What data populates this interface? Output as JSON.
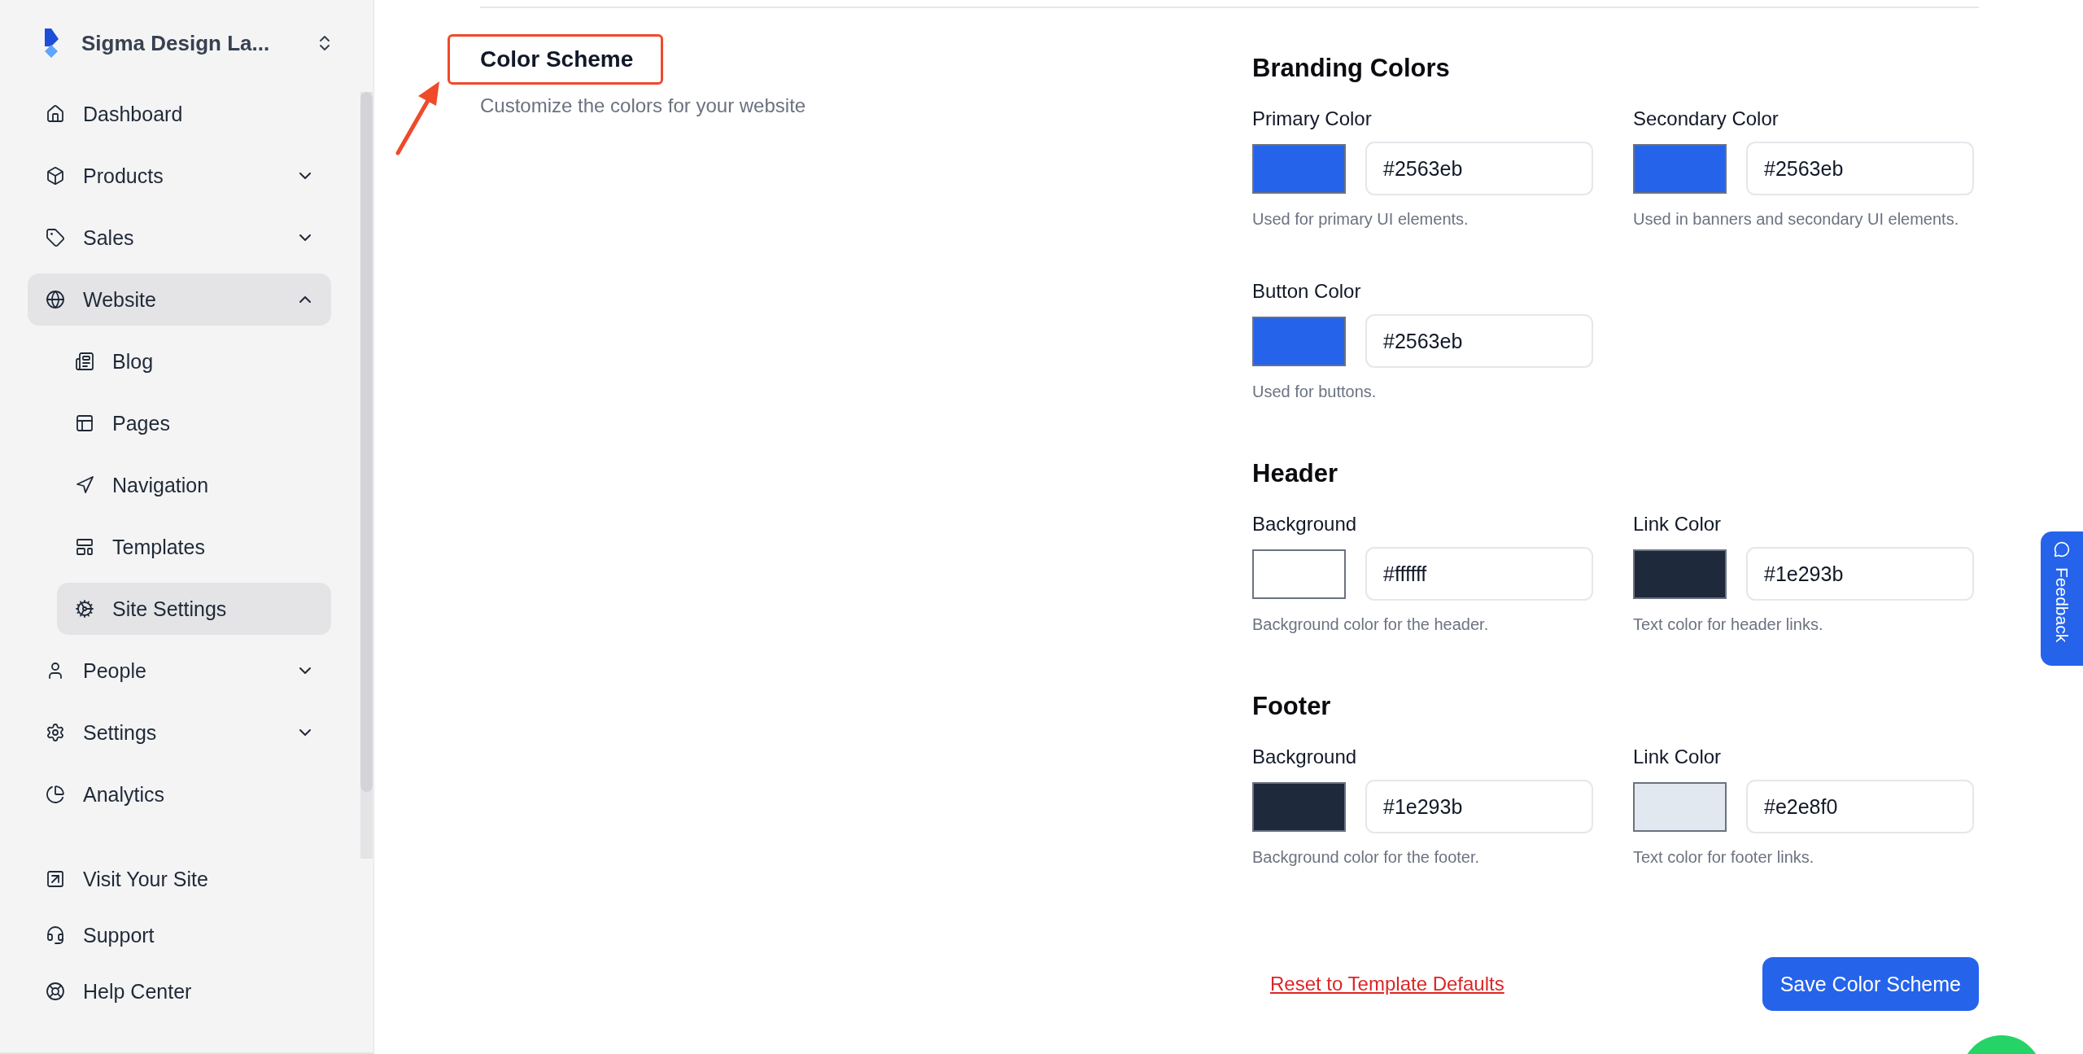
{
  "sidebar": {
    "workspace": "Sigma Design La...",
    "items": [
      {
        "label": "Dashboard",
        "selected": false
      },
      {
        "label": "Products",
        "selected": false,
        "expanded": false
      },
      {
        "label": "Sales",
        "selected": false,
        "expanded": false
      },
      {
        "label": "Website",
        "selected": true,
        "expanded": true,
        "children": [
          {
            "label": "Blog",
            "selected": false
          },
          {
            "label": "Pages",
            "selected": false
          },
          {
            "label": "Navigation",
            "selected": false
          },
          {
            "label": "Templates",
            "selected": false
          },
          {
            "label": "Site Settings",
            "selected": true
          }
        ]
      },
      {
        "label": "People",
        "selected": false,
        "expanded": false
      },
      {
        "label": "Settings",
        "selected": false,
        "expanded": false
      },
      {
        "label": "Analytics",
        "selected": false
      }
    ],
    "footer_links": [
      "Visit Your Site",
      "Support",
      "Help Center"
    ]
  },
  "page": {
    "title": "Color Scheme",
    "description": "Customize the colors for your website"
  },
  "sections": [
    {
      "title": "Branding Colors",
      "fields": [
        {
          "label": "Primary Color",
          "color": "#2563eb",
          "value": "#2563eb",
          "hint": "Used for primary UI elements."
        },
        {
          "label": "Secondary Color",
          "color": "#2563eb",
          "value": "#2563eb",
          "hint": "Used in banners and secondary UI elements."
        },
        {
          "label": "Button Color",
          "color": "#2563eb",
          "value": "#2563eb",
          "hint": "Used for buttons."
        }
      ]
    },
    {
      "title": "Header",
      "fields": [
        {
          "label": "Background",
          "color": "#ffffff",
          "value": "#ffffff",
          "hint": "Background color for the header."
        },
        {
          "label": "Link Color",
          "color": "#1e293b",
          "value": "#1e293b",
          "hint": "Text color for header links."
        }
      ]
    },
    {
      "title": "Footer",
      "fields": [
        {
          "label": "Background",
          "color": "#1e293b",
          "value": "#1e293b",
          "hint": "Background color for the footer."
        },
        {
          "label": "Link Color",
          "color": "#e2e8f0",
          "value": "#e2e8f0",
          "hint": "Text color for footer links."
        }
      ]
    }
  ],
  "actions": {
    "reset_link": "Reset to Template Defaults",
    "save_button": "Save Color Scheme"
  },
  "feedback_tab": "Feedback"
}
